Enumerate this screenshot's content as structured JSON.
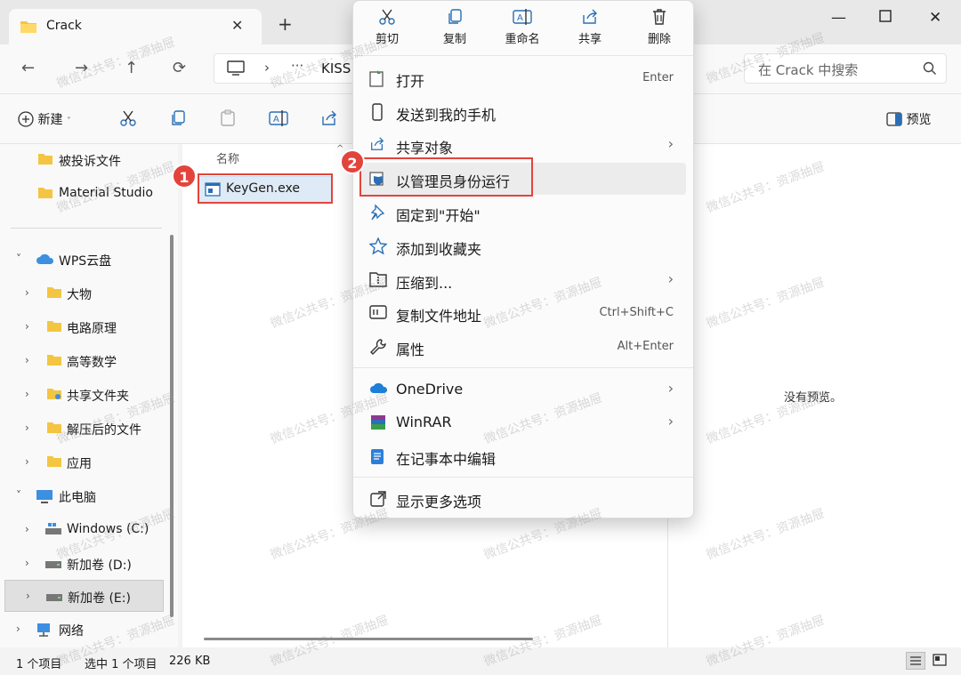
{
  "window": {
    "tab_title": "Crack",
    "new_tab": "+",
    "close_tab": "✕"
  },
  "nav": {
    "back": "←",
    "forward": "→",
    "up": "↑",
    "refresh": "⟳",
    "address_sep": "›",
    "address_more": "···",
    "address_crumb": "KISS",
    "search_placeholder": "在 Crack 中搜索"
  },
  "cmdbar": {
    "new_label": "新建",
    "preview_label": "预览"
  },
  "sidebar": {
    "items": [
      {
        "label": "被投诉文件"
      },
      {
        "label": "Material Studio"
      },
      {
        "label": "WPS云盘"
      },
      {
        "label": "大物"
      },
      {
        "label": "电路原理"
      },
      {
        "label": "高等数学"
      },
      {
        "label": "共享文件夹"
      },
      {
        "label": "解压后的文件"
      },
      {
        "label": "应用"
      },
      {
        "label": "此电脑"
      },
      {
        "label": "Windows (C:)"
      },
      {
        "label": "新加卷 (D:)"
      },
      {
        "label": "新加卷 (E:)"
      },
      {
        "label": "网络"
      }
    ]
  },
  "files": {
    "column_name": "名称",
    "rows": [
      {
        "name": "KeyGen.exe"
      }
    ]
  },
  "preview": {
    "empty_text": "没有预览。"
  },
  "status": {
    "count": "1 个项目",
    "selected": "选中 1 个项目",
    "size": "226 KB"
  },
  "callouts": {
    "step1": "1",
    "step2": "2"
  },
  "context_menu": {
    "actions": [
      {
        "label": "剪切",
        "icon": "scissors-icon"
      },
      {
        "label": "复制",
        "icon": "copy-icon"
      },
      {
        "label": "重命名",
        "icon": "rename-icon"
      },
      {
        "label": "共享",
        "icon": "share-icon"
      },
      {
        "label": "删除",
        "icon": "trash-icon"
      }
    ],
    "items": [
      {
        "label": "打开",
        "shortcut": "Enter"
      },
      {
        "label": "发送到我的手机"
      },
      {
        "label": "共享对象",
        "submenu": "›"
      },
      {
        "label": "以管理员身份运行"
      },
      {
        "label": "固定到\"开始\""
      },
      {
        "label": "添加到收藏夹"
      },
      {
        "label": "压缩到...",
        "submenu": "›"
      },
      {
        "label": "复制文件地址",
        "shortcut": "Ctrl+Shift+C"
      },
      {
        "label": "属性",
        "shortcut": "Alt+Enter"
      },
      {
        "label": "OneDrive",
        "submenu": "›"
      },
      {
        "label": "WinRAR",
        "submenu": "›"
      },
      {
        "label": "在记事本中编辑"
      },
      {
        "label": "显示更多选项"
      }
    ]
  },
  "watermark": "微信公共号：资源抽屉",
  "colors": {
    "accent_red": "#e2443c",
    "folder_yellow": "#f4c542",
    "selection_blue": "#dfeaf7"
  }
}
